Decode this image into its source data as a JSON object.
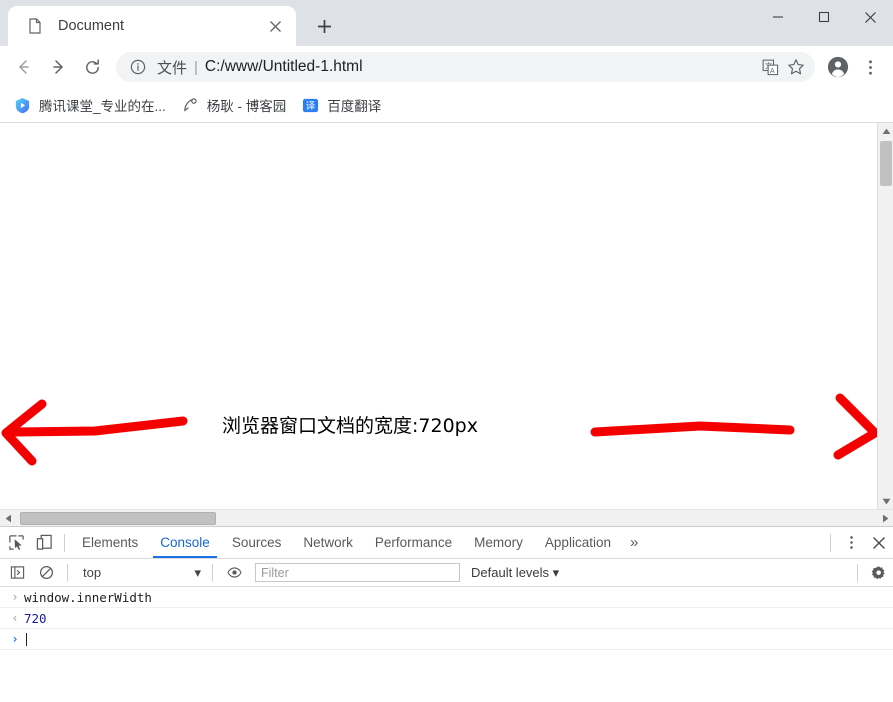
{
  "window": {
    "controls": [
      {
        "name": "minimize",
        "glyph": "minimize-icon"
      },
      {
        "name": "maximize",
        "glyph": "maximize-icon"
      },
      {
        "name": "close",
        "glyph": "close-icon"
      }
    ]
  },
  "tabstrip": {
    "tab_title": "Document",
    "tab_favicon": "document-icon",
    "close_label": "×",
    "newtab_label": "+"
  },
  "toolbar": {
    "back": "←",
    "forward": "→",
    "reload": "↻",
    "omnibox": {
      "info_icon": "info-circle-icon",
      "scheme_label": "文件",
      "separator": "|",
      "url": "C:/www/Untitled-1.html",
      "translate_icon": "translate-icon",
      "star_icon": "star-icon"
    },
    "profile_icon": "profile-avatar-icon",
    "menu_icon": "three-dot-menu-icon"
  },
  "bookmarks": [
    {
      "label": "腾讯课堂_专业的在...",
      "icon": "tencent-classroom-icon"
    },
    {
      "label": "杨耿 - 博客园",
      "icon": "cnblogs-icon"
    },
    {
      "label": "百度翻译",
      "icon": "baidu-translate-icon"
    }
  ],
  "page": {
    "text": "浏览器窗口文档的宽度:720px",
    "annotation_color": "#f40000",
    "annotations": [
      {
        "name": "left-arrow",
        "direction": "left"
      },
      {
        "name": "right-arrow",
        "direction": "right"
      }
    ]
  },
  "devtools": {
    "inspect_icon": "inspect-element-icon",
    "device_icon": "device-toolbar-icon",
    "tabs": [
      {
        "label": "Elements",
        "active": false
      },
      {
        "label": "Console",
        "active": true
      },
      {
        "label": "Sources",
        "active": false
      },
      {
        "label": "Network",
        "active": false
      },
      {
        "label": "Performance",
        "active": false
      },
      {
        "label": "Memory",
        "active": false
      },
      {
        "label": "Application",
        "active": false
      }
    ],
    "more_tabs": "»",
    "menu_icon": "three-dot-menu-icon",
    "close_icon": "close-icon",
    "console_toolbar": {
      "sidebar_icon": "console-sidebar-icon",
      "clear_icon": "clear-console-icon",
      "context": "top",
      "context_caret": "▾",
      "eye_icon": "live-expression-icon",
      "filter_placeholder": "Filter",
      "filter_value": "",
      "levels_label": "Default levels",
      "levels_caret": "▾",
      "settings_icon": "gear-icon"
    },
    "console_log": [
      {
        "type": "input",
        "gutter": "›",
        "text": "window.innerWidth"
      },
      {
        "type": "result",
        "gutter": "‹",
        "text": "720"
      },
      {
        "type": "prompt",
        "gutter": "›",
        "text": ""
      }
    ]
  },
  "colors": {
    "accent": "#1a73e8",
    "annotation_red": "#f40000",
    "result_blue": "#1a1aa6",
    "tabstrip_bg": "#dee1e6",
    "omnibox_bg": "#f1f3f4"
  }
}
